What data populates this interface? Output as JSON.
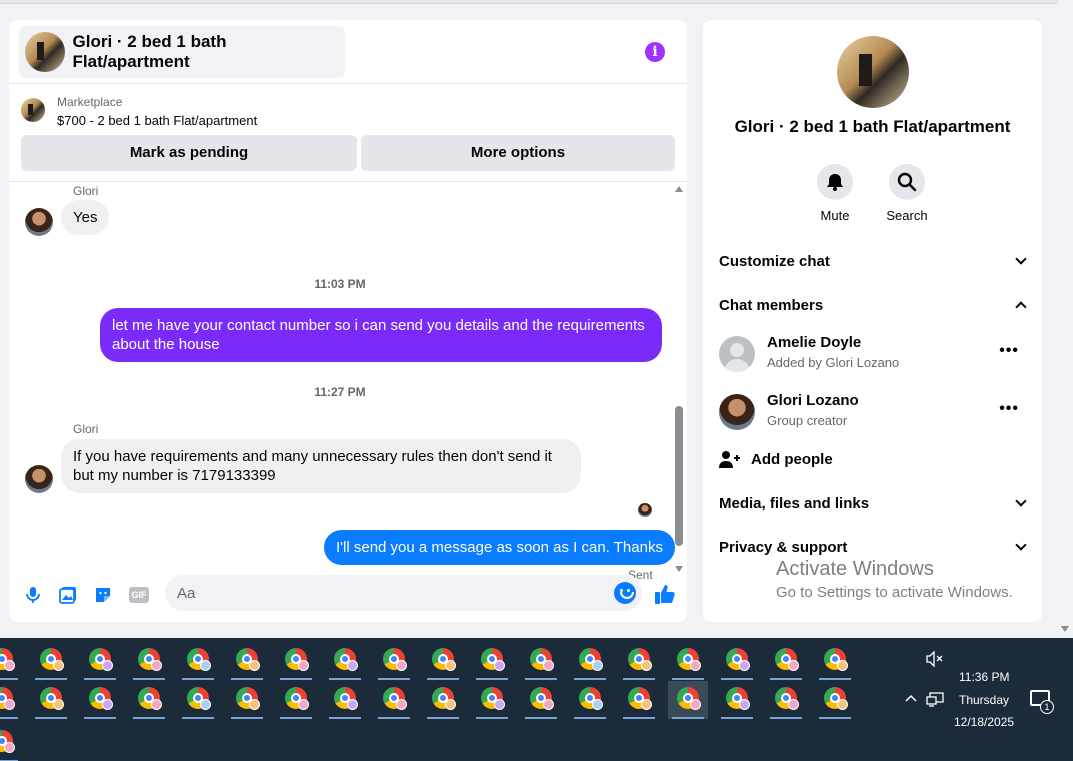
{
  "conversation": {
    "title": "Glori · 2 bed 1 bath Flat/apartment",
    "marketplace_label": "Marketplace",
    "listing": "$700 - 2 bed 1 bath Flat/apartment",
    "mark_pending": "Mark as pending",
    "more_options": "More options"
  },
  "messages": [
    {
      "sender": "Glori",
      "text": "Yes"
    },
    {
      "time": "11:03 PM"
    },
    {
      "text": "let me have your contact number so i can send you details and the requirements about the house"
    },
    {
      "time": "11:27 PM"
    },
    {
      "sender": "Glori",
      "text": "If you have requirements and many unnecessary rules then don't send it but my number is 7179133399"
    },
    {
      "text": "I'll send you a message as soon as I can. Thanks",
      "status": "Sent"
    }
  ],
  "composer": {
    "placeholder": "Aa",
    "icons": [
      "microphone-icon",
      "photo-icon",
      "sticker-icon",
      "gif-icon",
      "emoji-icon",
      "thumbs-up-icon"
    ]
  },
  "info": {
    "title": "Glori · 2 bed 1 bath Flat/apartment",
    "mute": "Mute",
    "search": "Search",
    "customize": "Customize chat",
    "members_heading": "Chat members",
    "members": [
      {
        "name": "Amelie Doyle",
        "sub": "Added by Glori Lozano"
      },
      {
        "name": "Glori Lozano",
        "sub": "Group creator"
      }
    ],
    "add_people": "Add people",
    "media": "Media, files and links",
    "privacy": "Privacy & support"
  },
  "watermark": {
    "line1": "Activate Windows",
    "line2": "Go to Settings to activate Windows."
  },
  "taskbar": {
    "time": "11:36 PM",
    "day": "Thursday",
    "date": "12/18/2025",
    "notifications": "1"
  },
  "colors": {
    "accent_purple": "#7b2bf9",
    "accent_blue": "#0a7cff",
    "info_icon": "#a033ff",
    "taskbar": "#1c2b3a"
  }
}
